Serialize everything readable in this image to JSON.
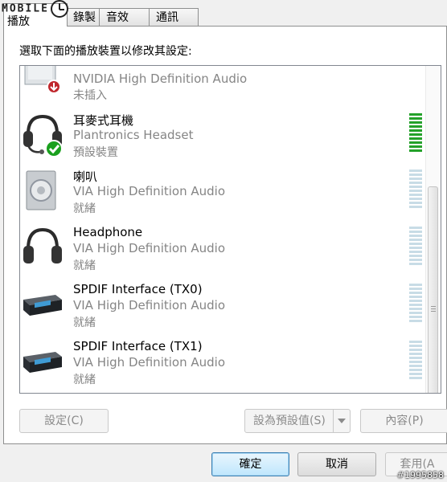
{
  "watermark": "MOBILE",
  "tabs": [
    {
      "label": "播放"
    },
    {
      "label": "錄製"
    },
    {
      "label": "音效"
    },
    {
      "label": "通訊"
    }
  ],
  "instruction": "選取下面的播放裝置以修改其設定:",
  "devices": [
    {
      "name": "NVIDIA High Definition Audio",
      "driver": "",
      "status": "未插入",
      "icon": "monitor-speaker-unplugged-icon"
    },
    {
      "name": "耳麥式耳機",
      "driver": "Plantronics Headset",
      "status": "預設裝置",
      "icon": "headset-default-icon"
    },
    {
      "name": "喇叭",
      "driver": "VIA High Definition Audio",
      "status": "就緒",
      "icon": "speaker-icon"
    },
    {
      "name": "Headphone",
      "driver": "VIA High Definition Audio",
      "status": "就緒",
      "icon": "headphone-icon"
    },
    {
      "name": "SPDIF Interface (TX0)",
      "driver": "VIA High Definition Audio",
      "status": "就緒",
      "icon": "spdif-device-icon"
    },
    {
      "name": "SPDIF Interface (TX1)",
      "driver": "VIA High Definition Audio",
      "status": "就緒",
      "icon": "spdif-device-icon"
    }
  ],
  "buttons": {
    "configure": "設定(C)",
    "set_default": "設為預設值(S)",
    "properties": "內容(P)",
    "ok": "確定",
    "cancel": "取消",
    "apply": "套用(A"
  },
  "image_id": "#1995858",
  "colors": {
    "meter_active": "#24a12a",
    "meter_idle": "#c8dce6",
    "default_check": "#1aa01e"
  }
}
